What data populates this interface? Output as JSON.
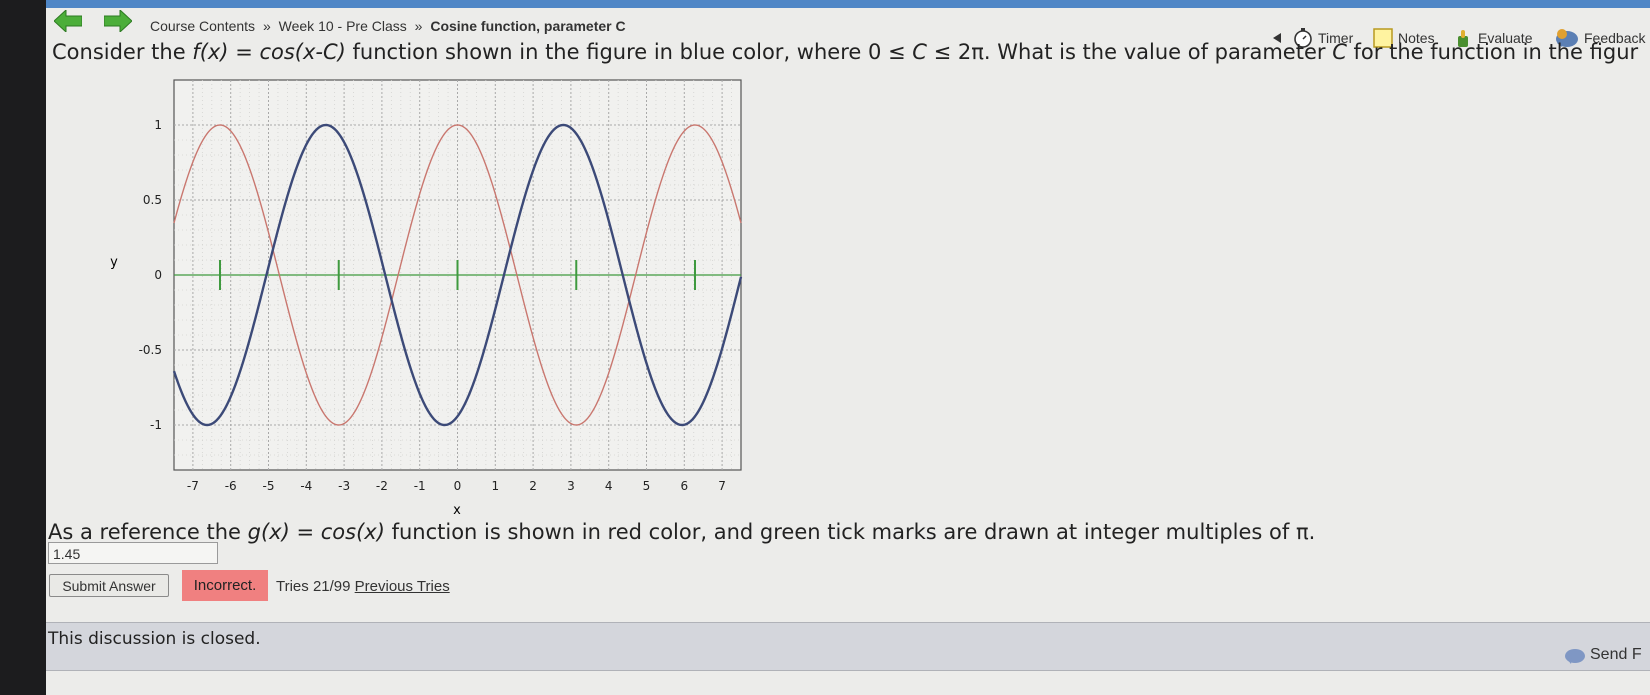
{
  "nav": {
    "breadcrumbs": [
      "Course Contents",
      "Week 10 - Pre Class",
      "Cosine function, parameter C"
    ],
    "separator": "»",
    "tools": {
      "timer": "Timer",
      "notes": "Notes",
      "evaluate": "Evaluate",
      "feedback": "Feedback"
    }
  },
  "question": {
    "pre": "Consider the ",
    "fx": "f(x)",
    "eq": " = ",
    "cos": "cos(x-C)",
    "mid": " function shown in the figure in blue color, where 0 ≤ ",
    "C1": "C",
    "post": " ≤ 2π. What is the value of parameter ",
    "C2": "C",
    "tail": " for the function in the figur"
  },
  "reference": {
    "pre": "As a reference the ",
    "gx": "g(x)",
    "eq": " = ",
    "cos": "cos(x)",
    "post": " function is shown in red color, and green tick marks are drawn at integer multiples of π."
  },
  "answer": {
    "value": "1.45"
  },
  "submit": {
    "label": "Submit Answer"
  },
  "status": {
    "incorrect": "Incorrect.",
    "tries": "Tries 21/99",
    "previous": "Previous Tries"
  },
  "discussion": {
    "message": "This discussion is closed.",
    "send": "Send F"
  },
  "colors": {
    "blue": "#3c4a78",
    "red": "#c9776f",
    "green": "#3f9a3f",
    "grid": "#a9a9a9"
  },
  "chart_data": {
    "type": "line",
    "xlabel": "x",
    "ylabel": "y",
    "xlim": [
      -7.5,
      7.5
    ],
    "ylim": [
      -1.3,
      1.3
    ],
    "xticks": [
      "-7",
      "-6",
      "-5",
      "-4",
      "-3",
      "-2",
      "-1",
      "0",
      "1",
      "2",
      "3",
      "4",
      "5",
      "6",
      "7"
    ],
    "yticks": [
      "1",
      "0.5",
      "0",
      "-0.5",
      "-1"
    ],
    "grid": true,
    "series": [
      {
        "function": "cos(x-C)",
        "color": "blue",
        "C": 2.8
      },
      {
        "function": "cos(x)",
        "color": "red",
        "C": 0
      }
    ],
    "green_ticks_x": [
      -6.283,
      -3.142,
      0,
      3.142,
      6.283
    ]
  }
}
